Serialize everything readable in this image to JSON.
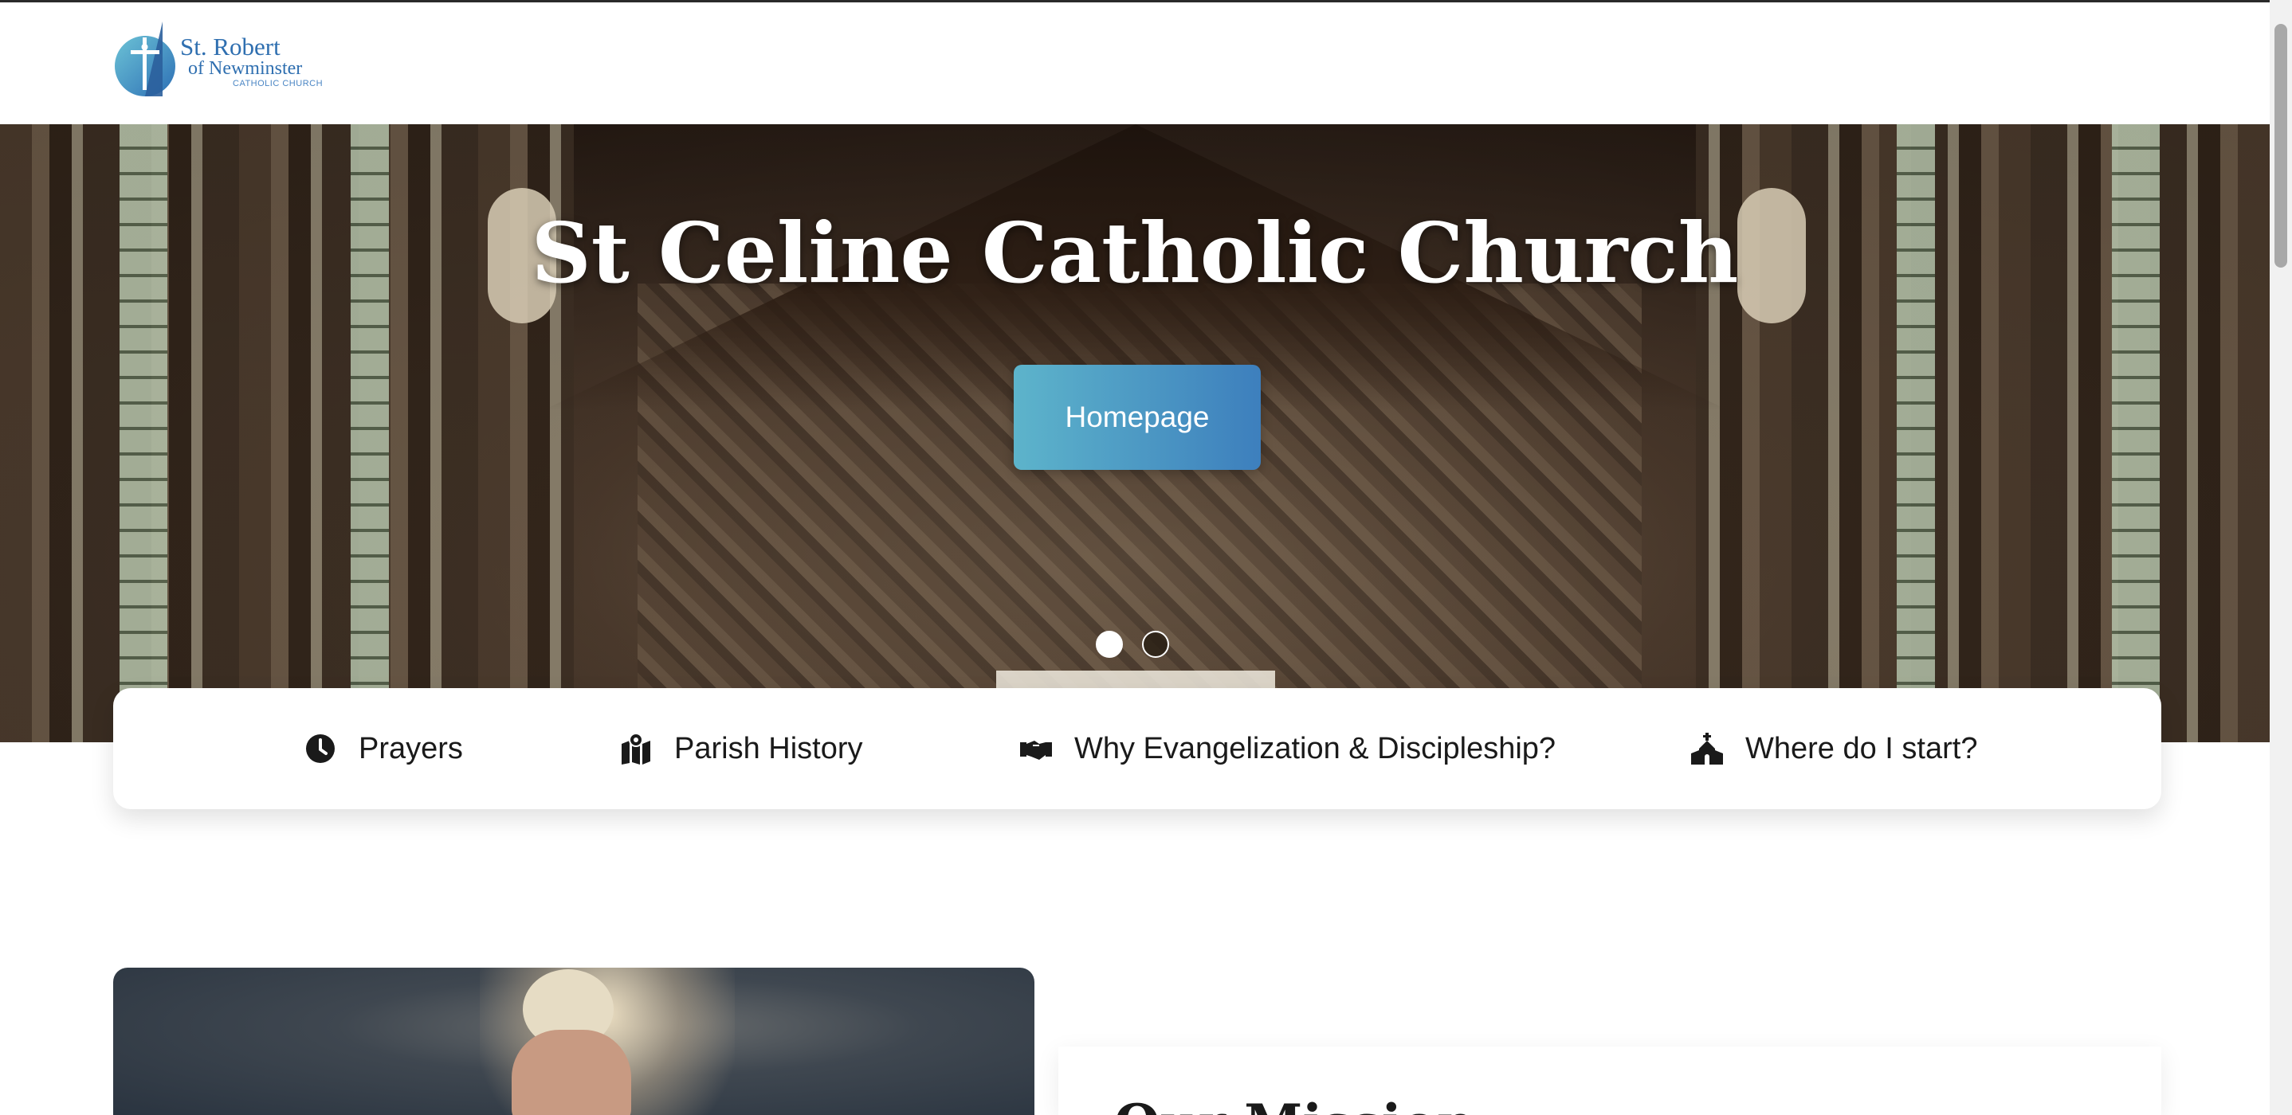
{
  "header": {
    "logo": {
      "line1": "St. Robert",
      "line2": "of Newminster",
      "line3": "CATHOLIC CHURCH"
    }
  },
  "hero": {
    "title": "St Celine Catholic Church",
    "button_label": "Homepage",
    "slides": {
      "count": 2,
      "active": 1
    }
  },
  "quick_nav": {
    "items": [
      {
        "label": "Prayers",
        "icon": "clock-icon"
      },
      {
        "label": "Parish History",
        "icon": "map-location-icon"
      },
      {
        "label": "Why Evangelization & Discipleship?",
        "icon": "handshake-icon"
      },
      {
        "label": "Where do I start?",
        "icon": "church-icon"
      }
    ]
  },
  "mission": {
    "title": "Our Mission"
  },
  "colors": {
    "accent_start": "#5db4cb",
    "accent_end": "#3d7fbd",
    "logo_blue": "#2f6fb0"
  }
}
